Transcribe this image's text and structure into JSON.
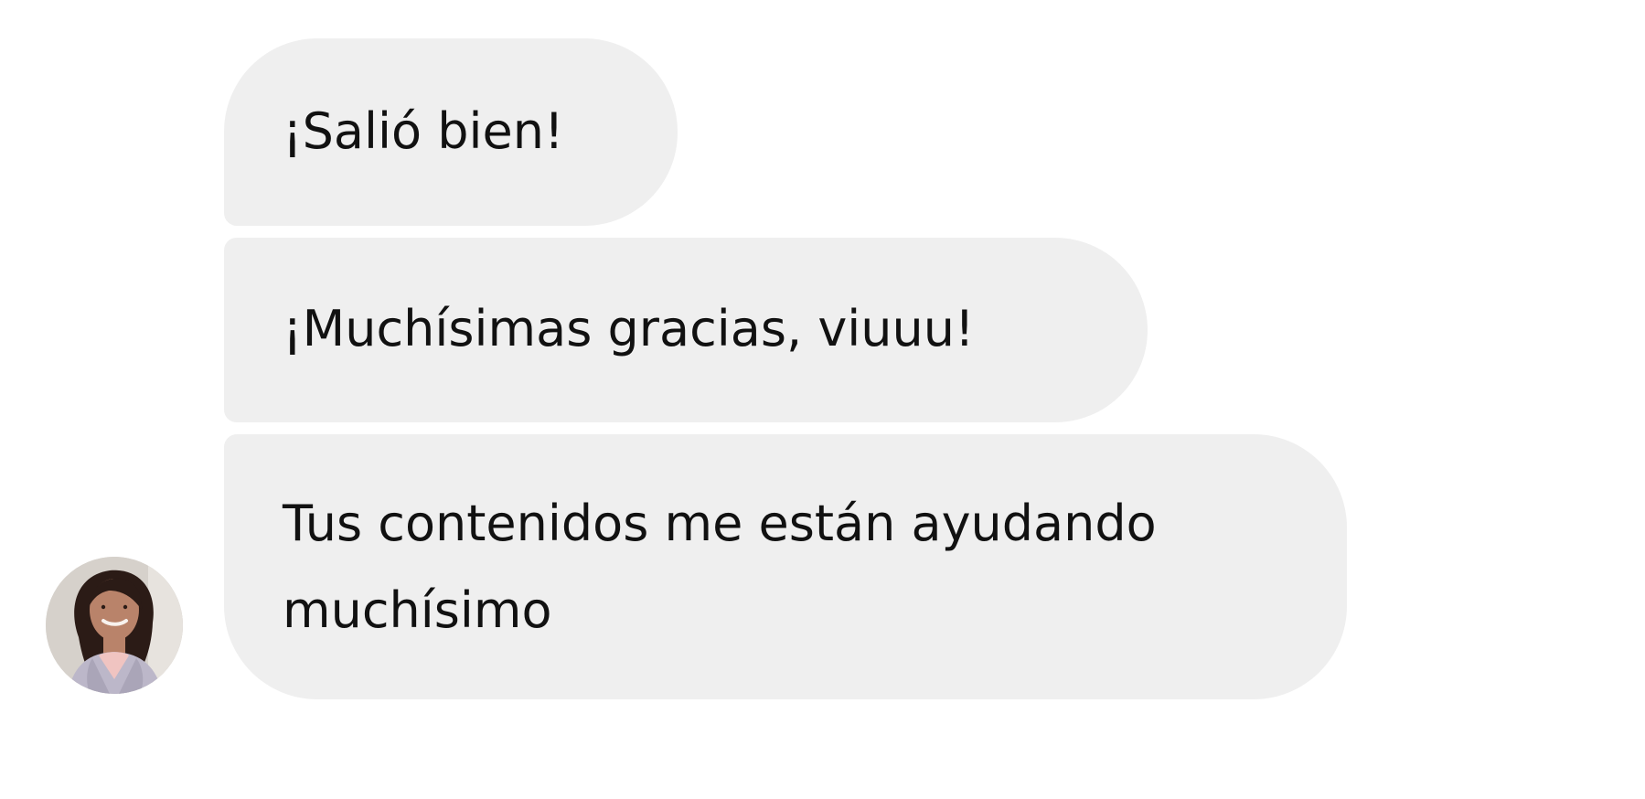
{
  "conversation": {
    "messages": [
      {
        "text": "¡Salió bien!"
      },
      {
        "text": "¡Muchísimas gracias, viuuu!"
      },
      {
        "text": "Tus contenidos me están ayudando muchísimo"
      }
    ],
    "sender": {
      "avatar_icon": "profile-photo"
    }
  }
}
